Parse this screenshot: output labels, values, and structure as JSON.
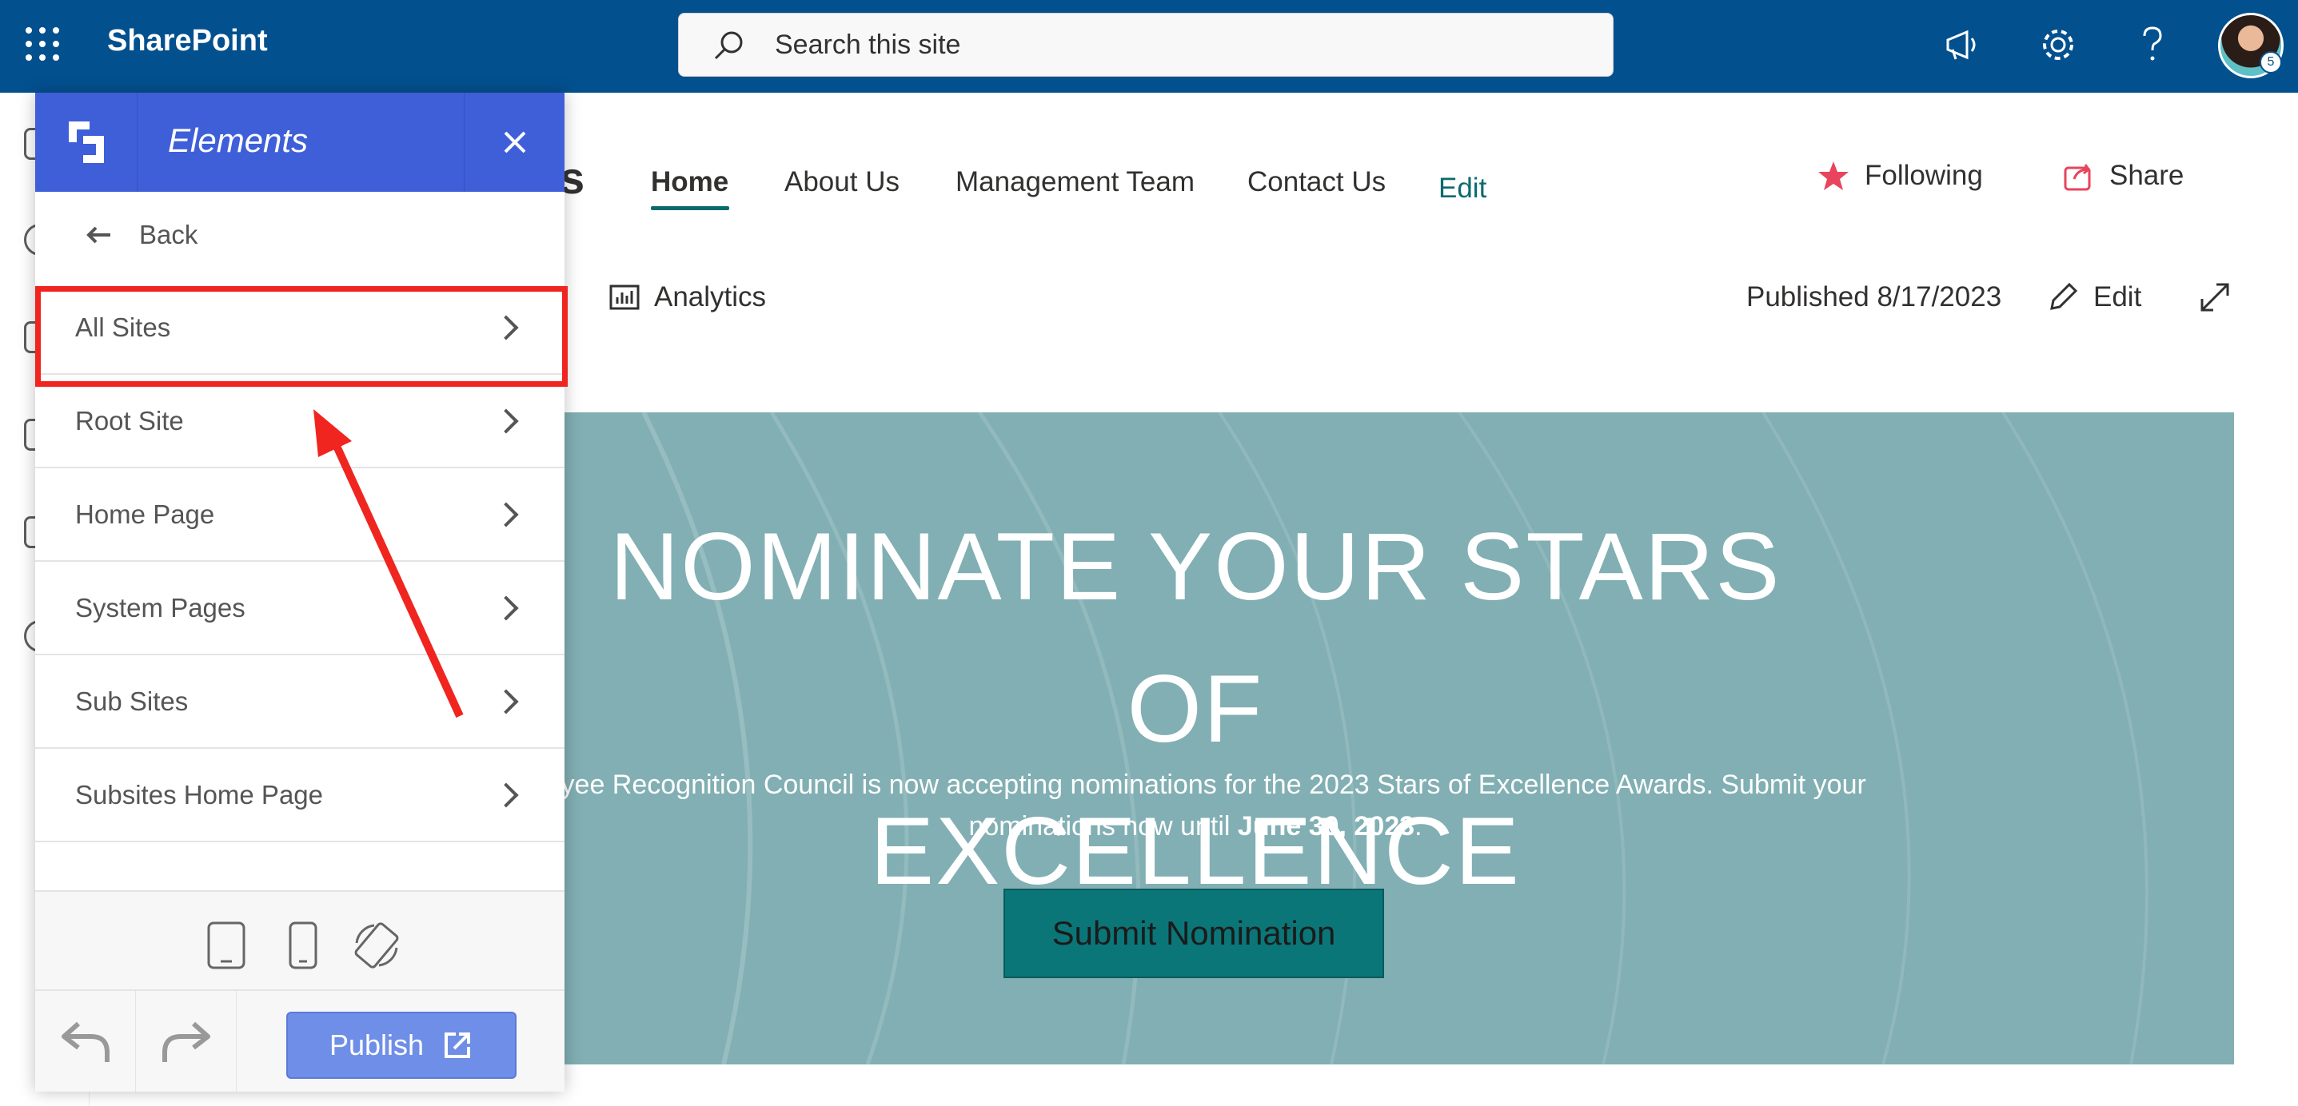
{
  "suite": {
    "app_name": "SharePoint",
    "search_placeholder": "Search this site",
    "avatar_badge": "5"
  },
  "site_nav": {
    "items": [
      "Home",
      "About Us",
      "Management Team",
      "Contact Us"
    ],
    "edit_label": "Edit",
    "partial_title": "s",
    "following_label": "Following",
    "share_label": "Share"
  },
  "command_bar": {
    "analytics_label": "Analytics",
    "published_label": "Published 8/17/2023",
    "edit_label": "Edit"
  },
  "hero": {
    "title_line1": "NOMINATE YOUR STARS OF",
    "title_line2": "EXCELLENCE",
    "description_line1": "ployee Recognition Council is now accepting nominations for the 2023 Stars of Excellence Awards. Submit your",
    "description_line2_prefix": "nominations now until ",
    "description_line2_bold": "June 30, 2023",
    "description_line2_suffix": ".",
    "button_label": "Submit Nomination",
    "background_color": "#81afb3",
    "button_color": "#0b7678"
  },
  "panel": {
    "title": "Elements",
    "back_label": "Back",
    "menu_items": [
      "All Sites",
      "Root Site",
      "Home Page",
      "System Pages",
      "Sub Sites",
      "Subsites Home Page"
    ],
    "publish_label": "Publish",
    "header_color": "#3f5fd9",
    "highlight_color": "#f0251f"
  }
}
